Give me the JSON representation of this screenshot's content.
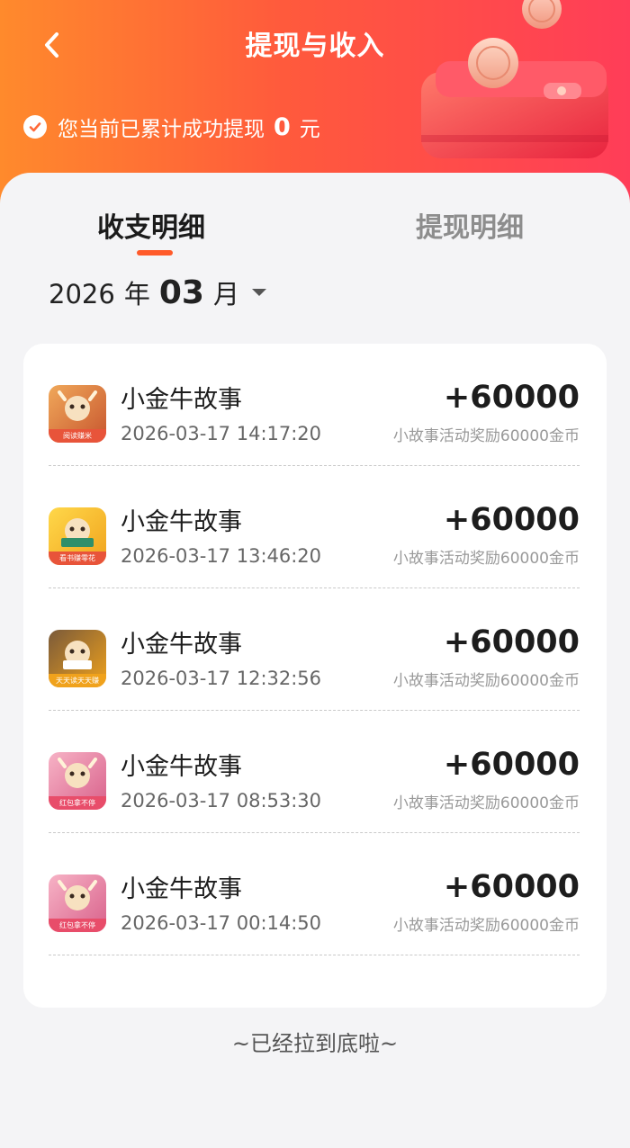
{
  "header": {
    "title": "提现与收入",
    "summary_prefix": "您当前已累计成功提现",
    "summary_amount": "0",
    "summary_unit": "元"
  },
  "tabs": [
    {
      "label": "收支明细",
      "active": true
    },
    {
      "label": "提现明细",
      "active": false
    }
  ],
  "month_selector": {
    "year": "2026",
    "year_unit": "年",
    "month": "03",
    "month_unit": "月"
  },
  "records": [
    {
      "app": "小金牛故事",
      "time": "2026-03-17 14:17:20",
      "amount": "+60000",
      "desc": "小故事活动奖励60000金币",
      "icon_caption": "阅读赚米",
      "icon_color": "#e8543a"
    },
    {
      "app": "小金牛故事",
      "time": "2026-03-17 13:46:20",
      "amount": "+60000",
      "desc": "小故事活动奖励60000金币",
      "icon_caption": "看书赚零花",
      "icon_color": "#f2b318"
    },
    {
      "app": "小金牛故事",
      "time": "2026-03-17 12:32:56",
      "amount": "+60000",
      "desc": "小故事活动奖励60000金币",
      "icon_caption": "天天读天天赚",
      "icon_color": "#f0a21c"
    },
    {
      "app": "小金牛故事",
      "time": "2026-03-17 08:53:30",
      "amount": "+60000",
      "desc": "小故事活动奖励60000金币",
      "icon_caption": "红包拿不停",
      "icon_color": "#e84d6a"
    },
    {
      "app": "小金牛故事",
      "time": "2026-03-17 00:14:50",
      "amount": "+60000",
      "desc": "小故事活动奖励60000金币",
      "icon_caption": "红包拿不停",
      "icon_color": "#e84d6a"
    }
  ],
  "footer": {
    "end_tip": "~已经拉到底啦~"
  },
  "colors": {
    "header_start": "#ff8a2c",
    "header_end": "#ff3d58",
    "accent": "#ff5a2a"
  }
}
